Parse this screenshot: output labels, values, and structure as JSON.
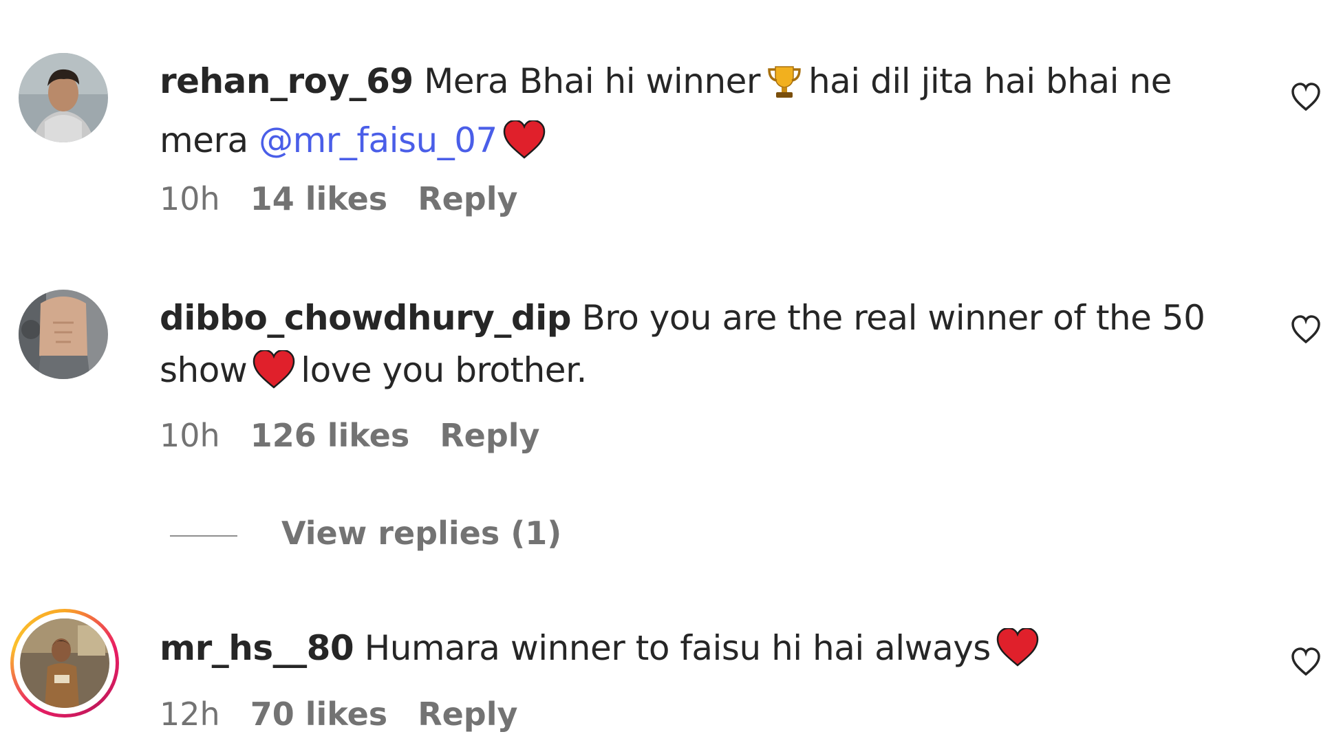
{
  "comments": [
    {
      "username": "rehan_roy_69",
      "text_part1": "Mera Bhai hi winner",
      "text_part2": "hai dil jita hai bhai ne mera",
      "mention": "@mr_faisu_07",
      "time": "10h",
      "likes": "14 likes",
      "reply": "Reply",
      "emojis": [
        "trophy-emoji",
        "red-heart-emoji"
      ]
    },
    {
      "username": "dibbo_chowdhury_dip",
      "text_part1": "Bro you are the real winner of the 50 show",
      "text_part2": "love you brother.",
      "time": "10h",
      "likes": "126 likes",
      "reply": "Reply",
      "view_replies": "View replies (1)",
      "emojis": [
        "red-heart-emoji"
      ]
    },
    {
      "username": "mr_hs__80",
      "text_part1": "Humara winner to faisu hi hai always",
      "time": "12h",
      "likes": "70 likes",
      "reply": "Reply",
      "has_story_ring": true,
      "emojis": [
        "red-heart-emoji"
      ]
    }
  ],
  "colors": {
    "text": "#262626",
    "meta": "#737373",
    "mention": "#4a5ee8",
    "heart": "#e0202b",
    "trophy": "#f2b01e"
  },
  "icons": [
    "heart-outline-icon"
  ]
}
